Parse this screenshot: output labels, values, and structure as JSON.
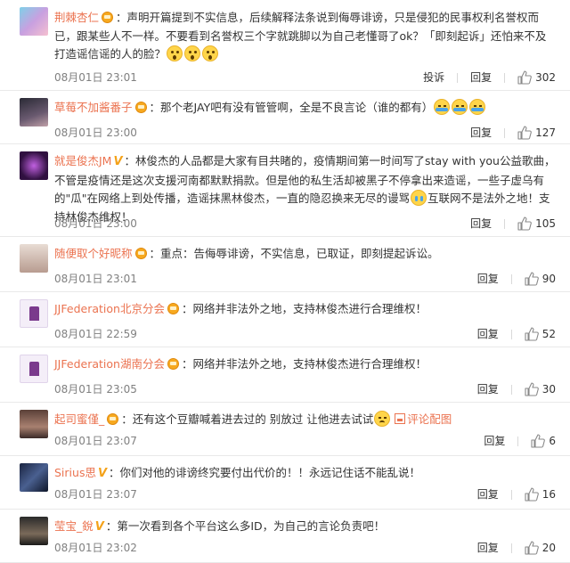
{
  "actions": {
    "report": "投诉",
    "reply": "回复"
  },
  "comments": [
    {
      "user": "荆棘杏仁",
      "text": "：声明开篇提到不实信息，后续解释法条说到侮辱诽谤，只是侵犯的民事权利名誉权而已，跟某些人不一样。不要看到名誉权三个字就跳脚以为自己老懂哥了ok？「即刻起诉」还怕来不及打造谣信谣的人的脸？",
      "time": "08月01日 23:01",
      "likes": "302"
    },
    {
      "user": "草莓不加酱番子",
      "text": "：那个老JAY吧有没有管管啊，全是不良言论（谁的都有）",
      "time": "08月01日 23:00",
      "likes": "127"
    },
    {
      "user": "就是俊杰JM",
      "text1": "：林俊杰的人品都是大家有目共睹的，疫情期间第一时间写了stay with you公益歌曲，不管是疫情还是这次支援河南都默默捐款。但是他的私生活却被黑子不停拿出来造谣，一些子虚乌有的\"瓜\"在网络上到处传播，造谣抹黑林俊杰，一直的隐忍换来无尽的谩骂",
      "text2": "互联网不是法外之地！支持林俊杰维权！",
      "time": "08月01日 23:00",
      "likes": "105"
    },
    {
      "user": "随便取个好昵称",
      "text": "：重点：告侮辱诽谤，不实信息，已取证，即刻提起诉讼。",
      "time": "08月01日 23:01",
      "likes": "90"
    },
    {
      "user": "JJFederation北京分会",
      "text": "：网络并非法外之地，支持林俊杰进行合理维权！",
      "time": "08月01日 22:59",
      "likes": "52"
    },
    {
      "user": "JJFederation湖南分会",
      "text": "：网络并非法外之地，支持林俊杰进行合理维权！",
      "time": "08月01日 23:05",
      "likes": "30"
    },
    {
      "user": "起司蜜僅_",
      "text": "：还有这个豆瓣喊着进去过的 别放过 让他进去试试",
      "link": "评论配图",
      "time": "08月01日 23:07",
      "likes": "6"
    },
    {
      "user": "Sirius思",
      "text": "：你们对他的诽谤终究要付出代价的！！永远记住话不能乱说！",
      "time": "08月01日 23:07",
      "likes": "16"
    },
    {
      "user": "莹宝_銳",
      "text": "：第一次看到各个平台这么多ID，为自己的言论负责吧！",
      "time": "08月01日 23:02",
      "likes": "20"
    }
  ]
}
